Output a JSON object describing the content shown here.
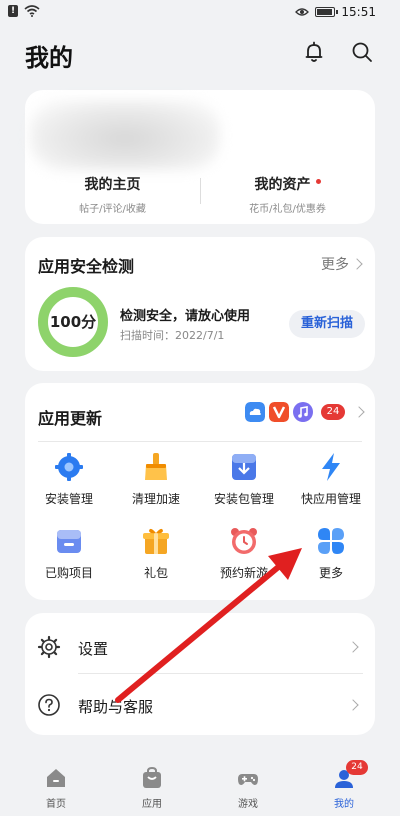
{
  "status_bar": {
    "time": "15:51",
    "notification_glyph": "!"
  },
  "header": {
    "title": "我的",
    "icons": [
      "bell-icon",
      "search-icon"
    ]
  },
  "profile": {
    "home_label": "我的主页",
    "home_sub": "帖子/评论/收藏",
    "assets_label": "我的资产",
    "assets_sub": "花币/礼包/优惠券"
  },
  "security": {
    "title": "应用安全检测",
    "more": "更多",
    "score": "100分",
    "score_value": 100,
    "status": "检测安全，请放心使用",
    "scan_time": "扫描时间：2022/7/1",
    "rescan_button": "重新扫描",
    "ring_color": "#8ed36b"
  },
  "updates": {
    "title": "应用更新",
    "badge": "24",
    "items": [
      {
        "label": "安装管理",
        "icon": "gear-icon"
      },
      {
        "label": "清理加速",
        "icon": "broom-icon"
      },
      {
        "label": "安装包管理",
        "icon": "package-icon"
      },
      {
        "label": "快应用管理",
        "icon": "lightning-icon"
      },
      {
        "label": "已购项目",
        "icon": "purchased-box-icon"
      },
      {
        "label": "礼包",
        "icon": "gift-icon"
      },
      {
        "label": "预约新游",
        "icon": "alarm-clock-icon"
      },
      {
        "label": "更多",
        "icon": "four-petal-icon"
      }
    ]
  },
  "settings": {
    "items": [
      {
        "label": "设置",
        "icon": "settings-gear-icon"
      },
      {
        "label": "帮助与客服",
        "icon": "help-question-icon"
      }
    ]
  },
  "bottom_nav": {
    "items": [
      {
        "label": "首页",
        "icon": "home-icon"
      },
      {
        "label": "应用",
        "icon": "app-bag-icon"
      },
      {
        "label": "游戏",
        "icon": "gamepad-icon"
      },
      {
        "label": "我的",
        "icon": "profile-icon",
        "badge": "24"
      }
    ]
  },
  "colors": {
    "accent": "#2a62d8",
    "badge": "#e53935",
    "ring": "#8ed36b",
    "background": "#f1f2f4",
    "annotation_arrow": "#e02020"
  }
}
